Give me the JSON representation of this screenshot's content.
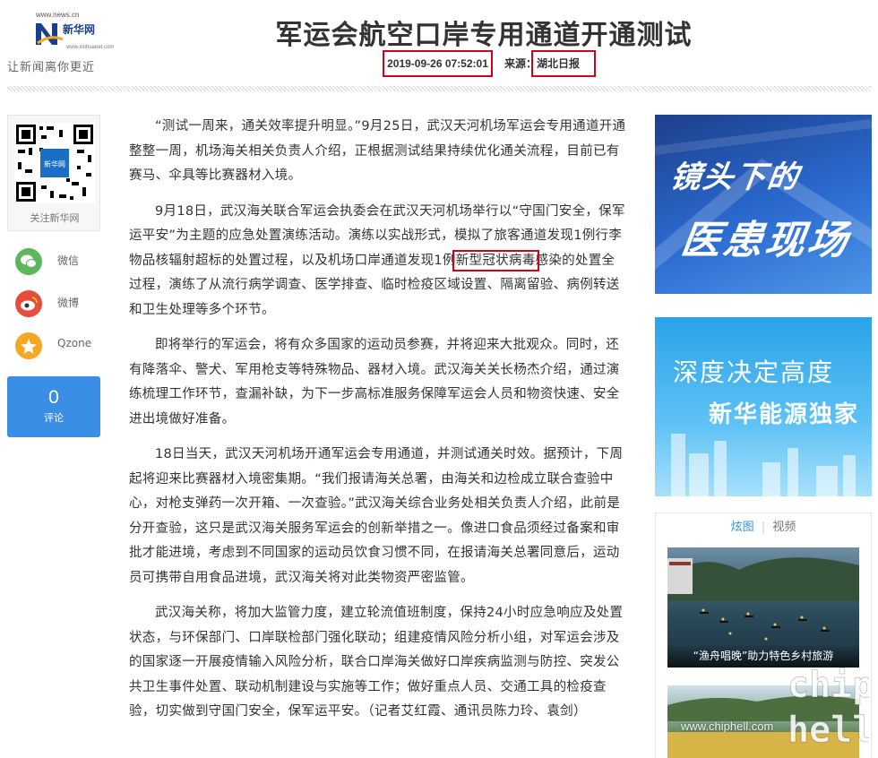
{
  "header": {
    "logo_url_text": "www.news.cn",
    "logo_brand": "新华网",
    "logo_sub": "www.xinhuanet.com",
    "slogan": "让新闻离你更近",
    "title": "军运会航空口岸专用通道开通测试",
    "timestamp": "2019-09-26 07:52:01",
    "source_label": "来源：",
    "source": "湖北日报"
  },
  "share": {
    "qr_label": "关注新华网",
    "items": [
      {
        "label": "微信",
        "icon": "wechat-icon",
        "color": "#5cb85c"
      },
      {
        "label": "微博",
        "icon": "weibo-icon",
        "color": "#e74c3c"
      },
      {
        "label": "Qzone",
        "icon": "qzone-icon",
        "color": "#f5a623"
      }
    ],
    "comment_count": "0",
    "comment_label": "评论"
  },
  "article": {
    "paragraphs": [
      "“测试一周来，通关效率提升明显。”9月25日，武汉天河机场军运会专用通道开通整整一周，机场海关相关负责人介绍，正根据测试结果持续优化通关流程，目前已有赛马、伞具等比赛器材入境。",
      "9月18日，武汉海关联合军运会执委会在武汉天河机场举行以“守国门安全，保军运平安”为主题的应急处置演练活动。演练以实战形式，模拟了旅客通道发现1例行李物品核辐射超标的处置过程，以及机场口岸通道发现1例",
      "新型冠状病毒",
      "感染的处置全过程，演练了从流行病学调查、医学排查、临时检疫区域设置、隔离留验、病例转送和卫生处理等多个环节。",
      "即将举行的军运会，将有众多国家的运动员参赛，并将迎来大批观众。同时，还有降落伞、警犬、军用枪支等特殊物品、器材入境。武汉海关关长杨杰介绍，通过演练梳理工作环节，查漏补缺，为下一步高标准服务保障军运会人员和物资快速、安全进出境做好准备。",
      "18日当天，武汉天河机场开通军运会专用通道，并测试通关时效。据预计，下周起将迎来比赛器材入境密集期。“我们报请海关总署，由海关和边检成立联合查验中心，对枪支弹药一次开箱、一次查验。”武汉海关综合业务处相关负责人介绍，此前是分开查验，这只是武汉海关服务军运会的创新举措之一。像进口食品须经过备案和审批才能进境，考虑到不同国家的运动员饮食习惯不同，在报请海关总署同意后，运动员可携带自用食品进境，武汉海关将对此类物资严密监管。",
      "武汉海关称，将加大监管力度，建立轮流值班制度，保持24小时应急响应及处置状态，与环保部门、口岸联检部门强化联动；组建疫情风险分析小组，对军运会涉及的国家逐一开展疫情输入风险分析，联合口岸海关做好口岸疾病监测与防控、突发公共卫生事件处置、联动机制建设与实施等工作；做好重点人员、交通工具的检疫查验，切实做到守国门安全，保军运平安。（记者艾红霞、通讯员陈力玲、袁剑）"
    ]
  },
  "sidebar": {
    "ad1_line1": "镜头下的",
    "ad1_line2": "医患现场",
    "ad2_line1": "深度决定高度",
    "ad2_line2": "新华能源独家",
    "tabs": [
      "炫图",
      "视频"
    ],
    "media1_caption": "“渔舟唱晚”助力特色乡村旅游"
  },
  "watermark": {
    "url": "www.chiphell.com",
    "logo_line1": "chip",
    "logo_line2": "hell"
  },
  "colors": {
    "accent": "#3a8ee6",
    "highlight_border": "#d0021b"
  }
}
